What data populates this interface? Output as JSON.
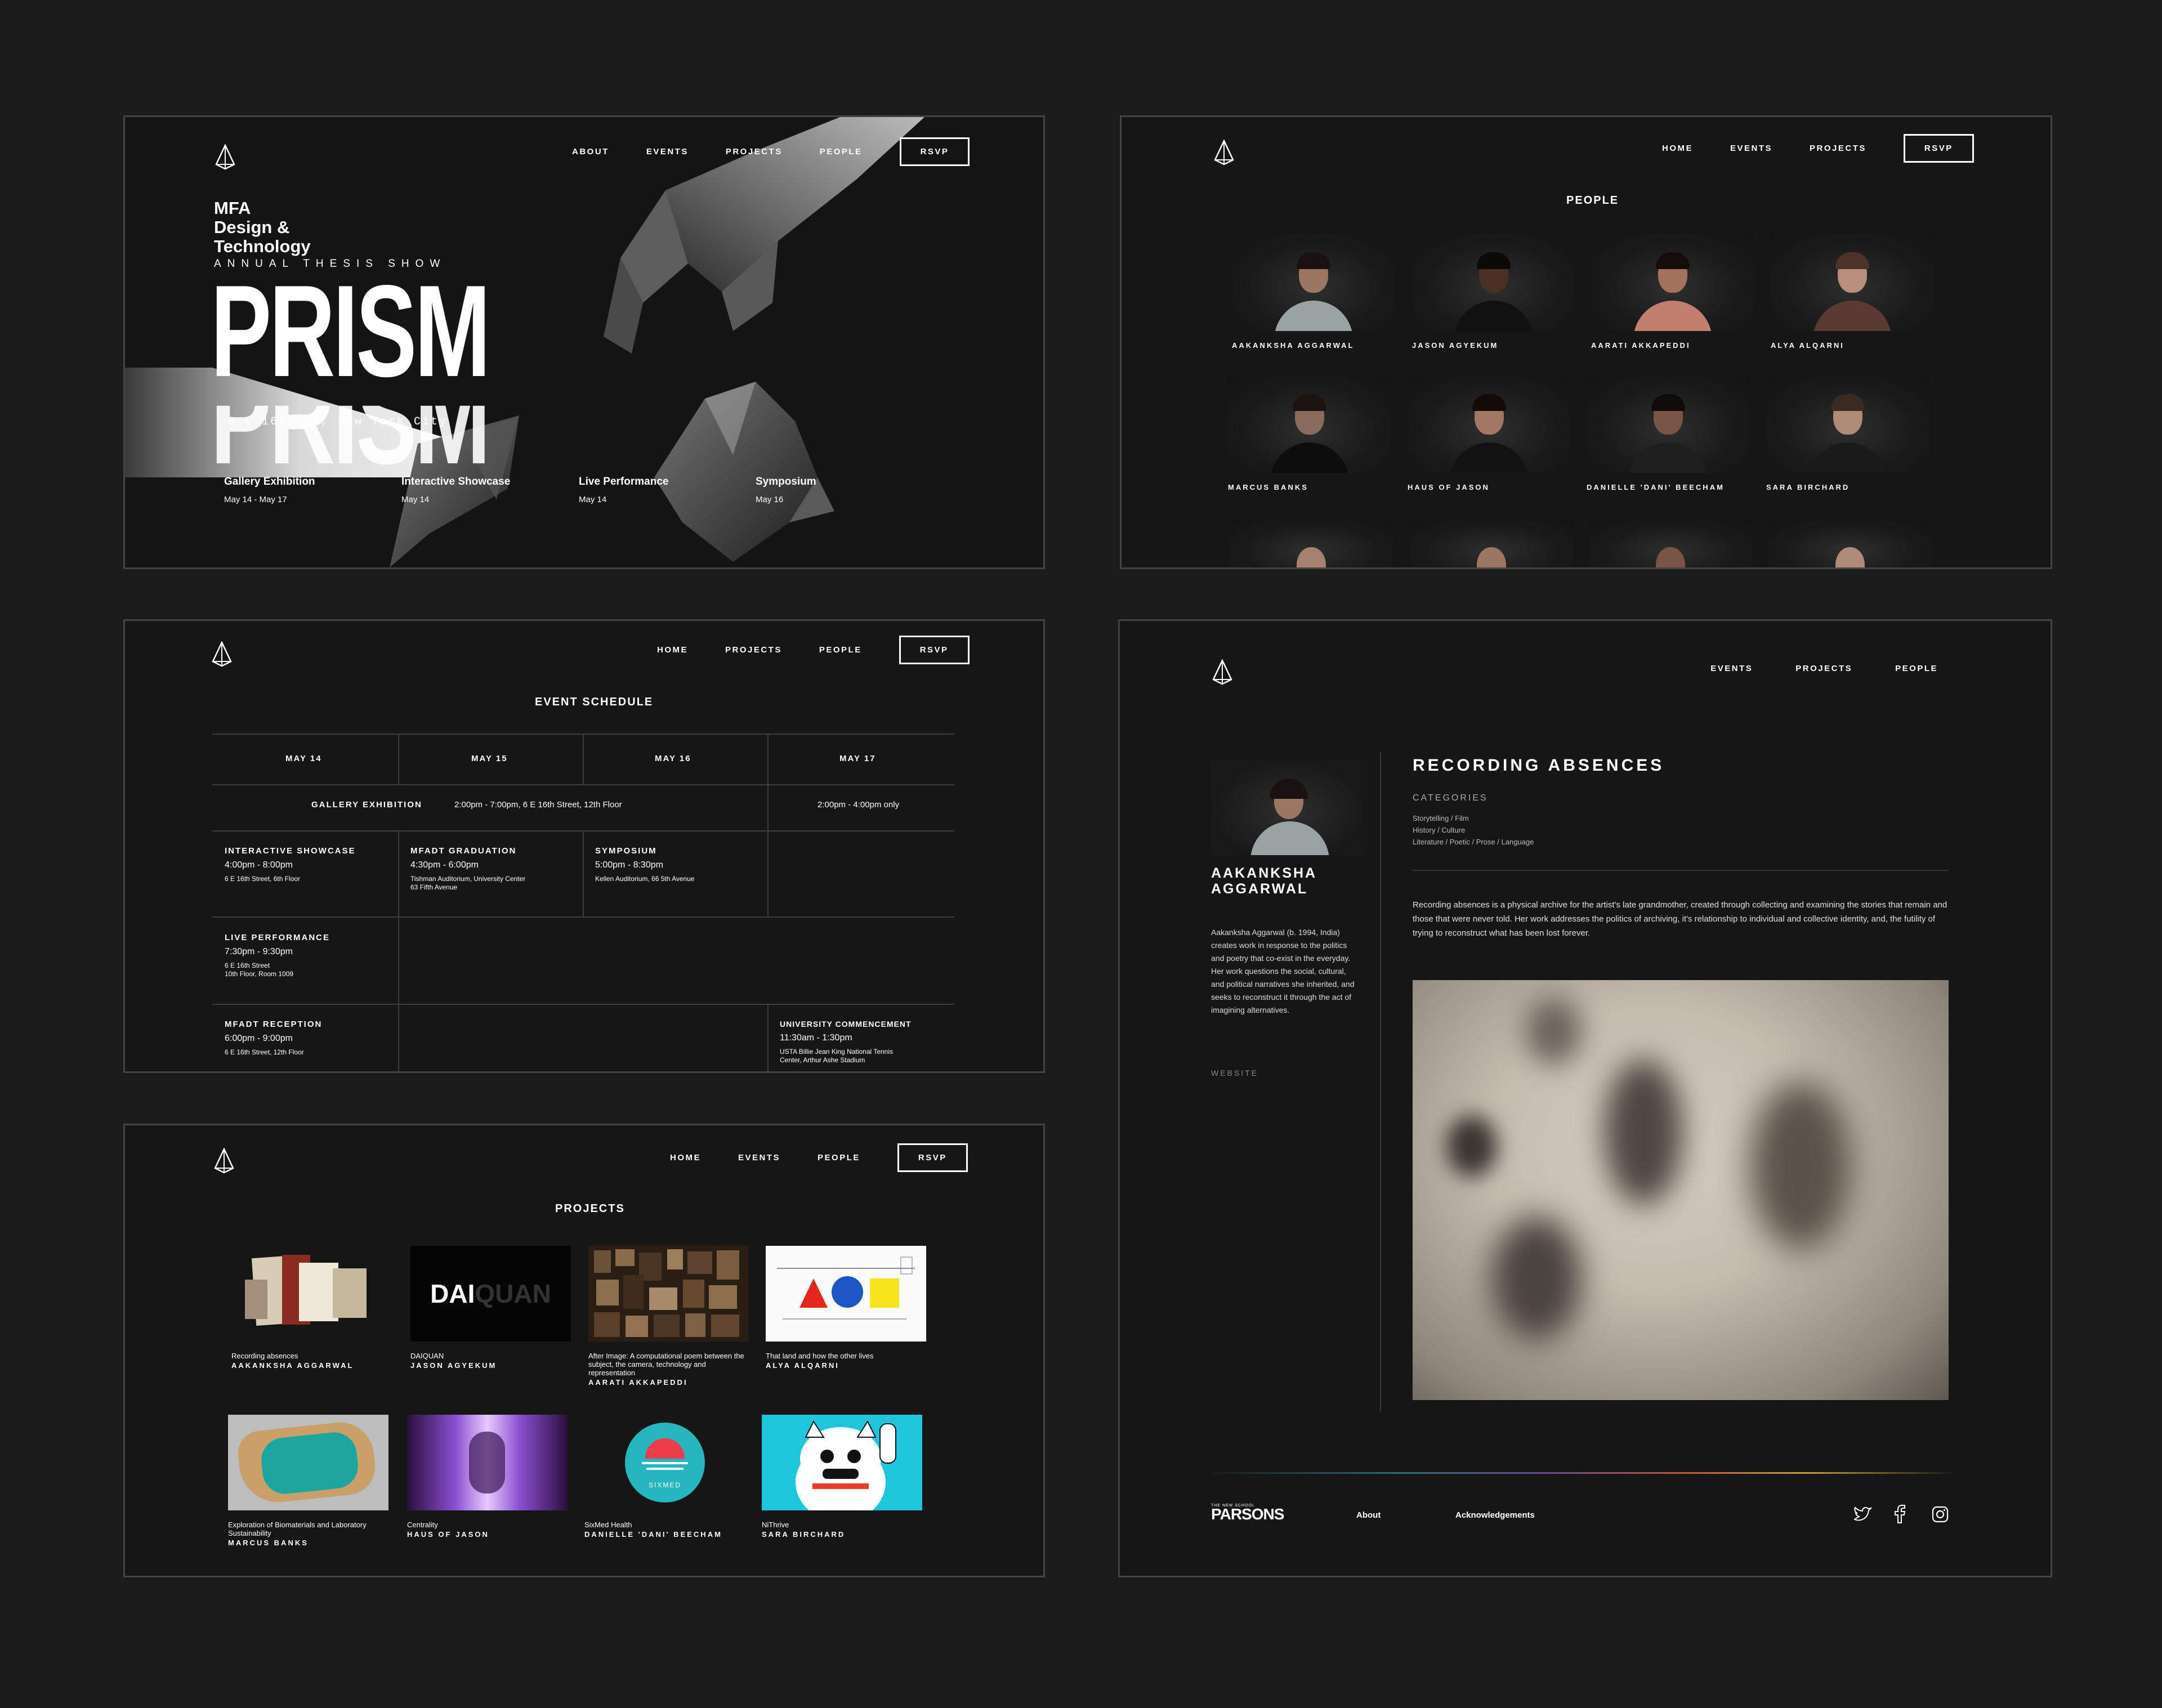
{
  "panel_home": {
    "nav": {
      "about": "ABOUT",
      "events": "EVENTS",
      "projects": "PROJECTS",
      "people": "PEOPLE",
      "rsvp": "RSVP"
    },
    "tagline": {
      "line1": "MFA",
      "line2": "Design &",
      "line3": "Technology"
    },
    "annual": "ANNUAL THESIS SHOW",
    "title": "PRISM",
    "address": "6 E 16th St, New York City",
    "events": [
      {
        "name": "Gallery Exhibition",
        "dates": "May 14 - May 17"
      },
      {
        "name": "Interactive Showcase",
        "dates": "May 14"
      },
      {
        "name": "Live Performance",
        "dates": "May 14"
      },
      {
        "name": "Symposium",
        "dates": "May 16"
      }
    ]
  },
  "panel_people": {
    "nav": {
      "home": "HOME",
      "events": "EVENTS",
      "projects": "PROJECTS",
      "rsvp": "RSVP"
    },
    "title": "PEOPLE",
    "people": [
      {
        "name": "AAKANKSHA AGGARWAL",
        "skin": "#9b7660",
        "shirt": "#9aa3a3",
        "hair": "#1a1110"
      },
      {
        "name": "JASON AGYEKUM",
        "skin": "#4a2f22",
        "shirt": "#111111",
        "hair": "#0c0a08"
      },
      {
        "name": "AARATI AKKAPEDDI",
        "skin": "#a4725c",
        "shirt": "#c07f6f",
        "hair": "#160d0a"
      },
      {
        "name": "ALYA ALQARNI",
        "skin": "#b98e7a",
        "shirt": "#5a3b34",
        "hair": "#4c3329"
      },
      {
        "name": "MARCUS BANKS",
        "skin": "#8a6a5c",
        "shirt": "#0d0d0d",
        "hair": "#1c1410"
      },
      {
        "name": "HAUS OF JASON",
        "skin": "#a17864",
        "shirt": "#121212",
        "hair": "#120b08"
      },
      {
        "name": "DANIELLE 'DANI' BEECHAM",
        "skin": "#7a5444",
        "shirt": "#1e1e1e",
        "hair": "#0f0b09"
      },
      {
        "name": "SARA BIRCHARD",
        "skin": "#b08a78",
        "shirt": "#1a1a1a",
        "hair": "#3a2a22"
      }
    ]
  },
  "panel_schedule": {
    "nav": {
      "home": "HOME",
      "projects": "PROJECTS",
      "people": "PEOPLE",
      "rsvp": "RSVP"
    },
    "title": "EVENT SCHEDULE",
    "days": [
      "MAY 14",
      "MAY 15",
      "MAY 16",
      "MAY 17"
    ],
    "gallery": {
      "label": "GALLERY EXHIBITION",
      "times": "2:00pm - 7:00pm, 6 E 16th Street, 12th Floor",
      "may17": "2:00pm - 4:00pm only"
    },
    "showcase": {
      "t": "INTERACTIVE SHOWCASE",
      "tm": "4:00pm - 8:00pm",
      "lc": "6 E 16th Street, 6th Floor"
    },
    "grad": {
      "t": "MFADT GRADUATION",
      "tm": "4:30pm - 6:00pm",
      "lc1": "Tishman Auditorium, University Center",
      "lc2": "63 Fifth Avenue"
    },
    "symp": {
      "t": "SYMPOSIUM",
      "tm": "5:00pm - 8:30pm",
      "lc": "Kellen Auditorium, 66 5th Avenue"
    },
    "live": {
      "t": "LIVE PERFORMANCE",
      "tm": "7:30pm - 9:30pm",
      "lc1": "6 E 16th Street",
      "lc2": "10th Floor, Room 1009"
    },
    "reception": {
      "t": "MFADT RECEPTION",
      "tm": "6:00pm - 9:00pm",
      "lc": "6 E 16th Street, 12th Floor"
    },
    "commencement": {
      "t": "UNIVERSITY COMMENCEMENT",
      "tm": "11:30am - 1:30pm",
      "lc1": "USTA Billie Jean King National Tennis",
      "lc2": "Center, Arthur Ashe Stadium"
    }
  },
  "panel_projects": {
    "nav": {
      "home": "HOME",
      "events": "EVENTS",
      "people": "PEOPLE",
      "rsvp": "RSVP"
    },
    "title": "PROJECTS",
    "projects": [
      {
        "title": "Recording absences",
        "author": "AAKANKSHA AGGARWAL"
      },
      {
        "title": "DAIQUAN",
        "author": "JASON AGYEKUM",
        "logo_a": "DAI",
        "logo_b": "QUAN"
      },
      {
        "title": "After Image: A computational poem between the subject, the camera, technology and representation",
        "author": "AARATI AKKAPEDDI"
      },
      {
        "title": "That land and how the other lives",
        "author": "ALYA ALQARNI"
      },
      {
        "title": "Exploration of Biomaterials and Laboratory Sustainability",
        "author": "MARCUS BANKS"
      },
      {
        "title": "Centrality",
        "author": "HAUS OF JASON"
      },
      {
        "title": "SixMed Health",
        "author": "DANIELLE 'DANI' BEECHAM",
        "logo": "SIXMED"
      },
      {
        "title": "NiThrive",
        "author": "SARA BIRCHARD"
      }
    ]
  },
  "panel_detail": {
    "nav": {
      "events": "EVENTS",
      "projects": "PROJECTS",
      "people": "PEOPLE"
    },
    "artist": "AAKANKSHA AGGARWAL",
    "bio": "Aakanksha Aggarwal (b. 1994, India) creates work in response to the politics and poetry that co-exist in the everyday. Her work questions the social, cultural, and political narratives she inherited, and seeks to reconstruct it through the act of imagining alternatives.",
    "website": "WEBSITE",
    "project_title": "RECORDING ABSENCES",
    "categories_label": "CATEGORIES",
    "categories": [
      "Storytelling / Film",
      "History / Culture",
      "Literature / Poetic / Prose / Language"
    ],
    "description": "Recording absences is a physical archive for the artist's late grandmother, created through collecting and examining the stories that remain and those that were never told. Her work addresses the politics of archiving, it's relationship to individual and collective identity, and, the futility of trying to reconstruct what has been lost forever.",
    "footer": {
      "brand_small": "THE NEW SCHOOL",
      "brand": "PARSONS",
      "about": "About",
      "ack": "Acknowledgements"
    }
  },
  "colors": {
    "background": "#1b1b1b",
    "panel": "#161616",
    "border": "#444444",
    "text": "#ffffff"
  }
}
